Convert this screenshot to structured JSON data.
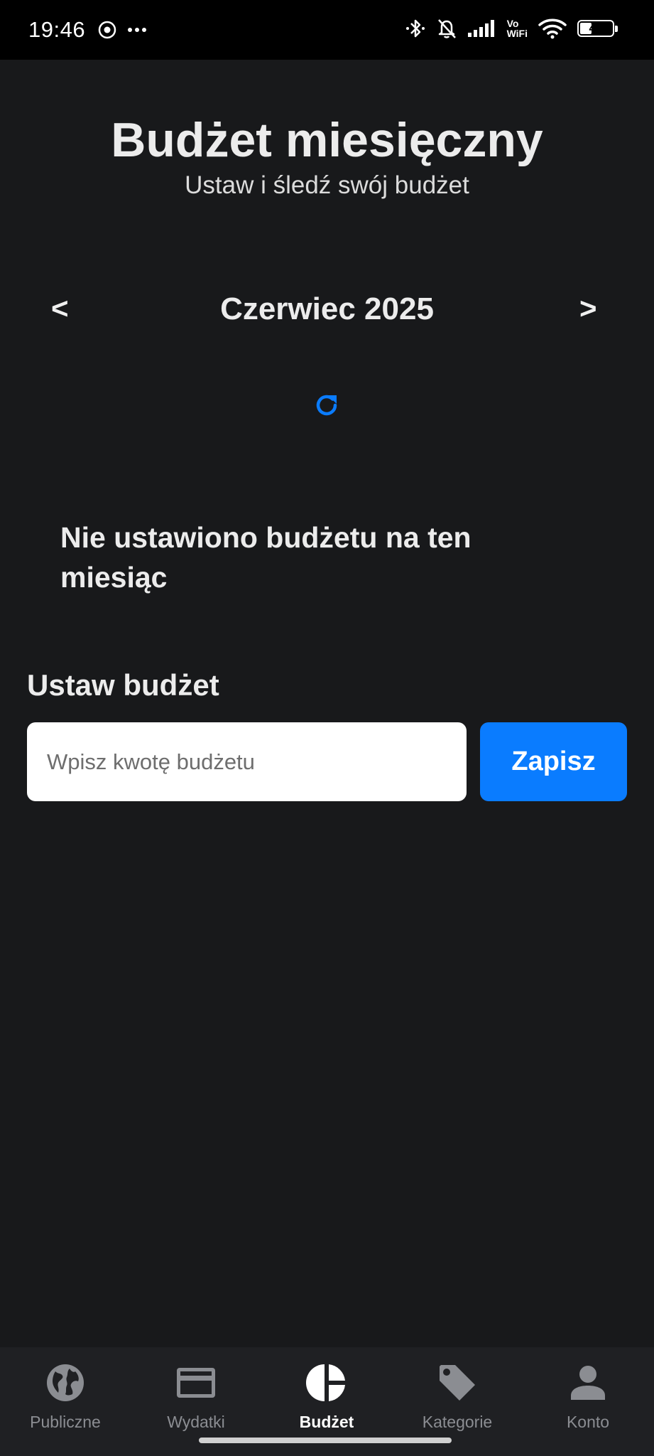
{
  "status_bar": {
    "time": "19:46",
    "battery": "41",
    "battery_level": 0.41,
    "network_label_top": "Vo",
    "network_label_bottom": "WiFi",
    "icons": [
      "record-icon",
      "more-icon",
      "bluetooth-icon",
      "bell-off-icon",
      "signal-icon",
      "vowifi-icon",
      "wifi-icon",
      "battery-icon"
    ]
  },
  "header": {
    "title": "Budżet miesięczny",
    "subtitle": "Ustaw i śledź swój budżet"
  },
  "month_nav": {
    "prev": "<",
    "next": ">",
    "label": "Czerwiec 2025"
  },
  "refresh_icon": "refresh-icon",
  "message": "Nie ustawiono budżetu na ten miesiąc",
  "set_budget": {
    "heading": "Ustaw budżet",
    "input_value": "",
    "input_placeholder": "Wpisz kwotę budżetu",
    "save_label": "Zapisz"
  },
  "bottom_nav": {
    "items": [
      {
        "label": "Publiczne",
        "icon": "globe-icon",
        "active": false
      },
      {
        "label": "Wydatki",
        "icon": "credit-card-icon",
        "active": false
      },
      {
        "label": "Budżet",
        "icon": "pie-chart-icon",
        "active": true
      },
      {
        "label": "Kategorie",
        "icon": "tag-icon",
        "active": false
      },
      {
        "label": "Konto",
        "icon": "person-icon",
        "active": false
      }
    ]
  },
  "colors": {
    "background": "#18191b",
    "accent": "#0a7cff",
    "nav_background": "#1f2023",
    "nav_inactive": "#8b8d92",
    "nav_active": "#ffffff"
  }
}
